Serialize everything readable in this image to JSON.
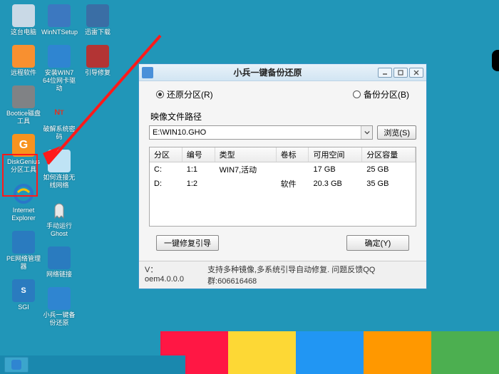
{
  "desktop": {
    "col1": [
      {
        "name": "pc",
        "label": "这台电脑",
        "color": "#c9d9e6"
      },
      {
        "name": "remote",
        "label": "远程软件",
        "color": "#f89030"
      },
      {
        "name": "bootice",
        "label": "Bootice磁盘工具",
        "color": "#808285"
      },
      {
        "name": "diskgenius",
        "label": "DiskGenius分区工具",
        "color": "#f7931e"
      },
      {
        "name": "ie",
        "label": "Internet Explorer",
        "color": "#2a77c9"
      },
      {
        "name": "pe-net",
        "label": "PE网络管理器",
        "color": "#2a7bbf"
      },
      {
        "name": "sgi",
        "label": "SGI",
        "color": "#2a7bbf"
      }
    ],
    "col2": [
      {
        "name": "winnt",
        "label": "WinNTSetup",
        "color": "#3c78c0"
      },
      {
        "name": "win764",
        "label": "安装WIN7 64位网卡驱动",
        "color": "#2f85d1"
      },
      {
        "name": "crack",
        "label": "破解系统密码",
        "color": "#ffffff"
      },
      {
        "name": "wifi",
        "label": "如何连接无线网络",
        "color": "#bfe3f5"
      },
      {
        "name": "ghost",
        "label": "手动运行Ghost",
        "color": "#e1e1e1"
      },
      {
        "name": "netlink",
        "label": "网络链接",
        "color": "#2a7bbf"
      },
      {
        "name": "backup",
        "label": "小兵一键备份还原",
        "color": "#2f85d1"
      }
    ],
    "col3": [
      {
        "name": "xunlei",
        "label": "迅雷下载",
        "color": "#3a6ea5"
      },
      {
        "name": "recover",
        "label": "引导修复",
        "color": "#b33434"
      }
    ]
  },
  "dialog": {
    "title": "小兵一键备份还原",
    "radio_restore": "还原分区(R)",
    "radio_backup": "备份分区(B)",
    "image_path_label": "映像文件路径",
    "path_value": "E:\\WIN10.GHO",
    "browse": "浏览(S)",
    "table": {
      "headers": [
        "分区",
        "编号",
        "类型",
        "卷标",
        "可用空间",
        "分区容量"
      ],
      "rows": [
        [
          "C:",
          "1:1",
          "WIN7,活动",
          "",
          "17 GB",
          "25 GB"
        ],
        [
          "D:",
          "1:2",
          "",
          "软件",
          "20.3 GB",
          "35 GB"
        ]
      ]
    },
    "repair_boot": "一键修复引导",
    "confirm": "确定(Y)",
    "status_version": "V：oem4.0.0.0",
    "status_text": "支持多种镜像,多系统引导自动修复. 问题反馈QQ群:606616468"
  }
}
